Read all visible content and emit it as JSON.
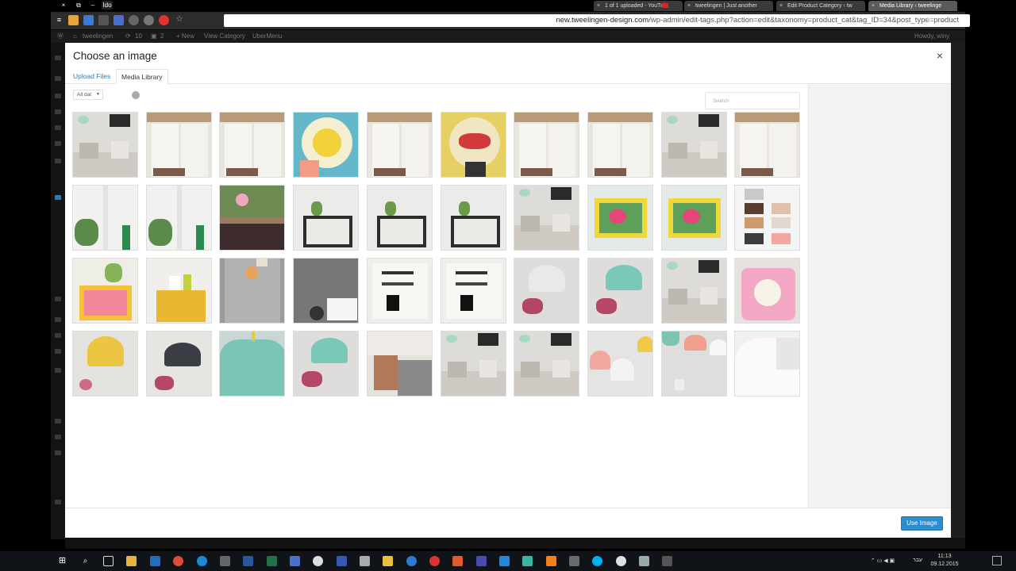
{
  "browser": {
    "window_controls": [
      "×",
      "⧉",
      "–"
    ],
    "profile_label": "Ido",
    "tabs": [
      {
        "title": "1 of 1 uploaded - YouTub",
        "has_youtube_icon": true,
        "active": false
      },
      {
        "title": "tweelingen | Just another",
        "active": false
      },
      {
        "title": "Edit Product Category ‹ tw",
        "active": false
      },
      {
        "title": "Media Library ‹ tweelinge",
        "active": true
      }
    ],
    "url": {
      "domain": "new.tweelingen-design.com",
      "path": "/wp-admin/edit-tags.php?action=edit&taxonomy=product_cat&tag_ID=34&post_type=product"
    }
  },
  "admin_bar": {
    "site_name": "tweelingen",
    "updates": "10",
    "comments": "2",
    "new_label": "+ New",
    "view_label": "View Category",
    "ubermenu_label": "UberMenu",
    "howdy": "Howdy, winy"
  },
  "modal": {
    "title": "Choose an image",
    "close_symbol": "×",
    "tabs": [
      {
        "label": "Upload Files",
        "active": false
      },
      {
        "label": "Media Library",
        "active": true
      }
    ],
    "filter": {
      "selected": "All dat",
      "caret": "▼"
    },
    "search_placeholder": "Search",
    "use_button_label": "Use Image"
  },
  "media_items": [
    {
      "scene": "sofa-pillows"
    },
    {
      "scene": "kitchen"
    },
    {
      "scene": "kitchen"
    },
    {
      "scene": "round-badge-blue"
    },
    {
      "scene": "kitchen"
    },
    {
      "scene": "round-badge-yellow"
    },
    {
      "scene": "kitchen"
    },
    {
      "scene": "kitchen"
    },
    {
      "scene": "sofa-pillows"
    },
    {
      "scene": "kitchen"
    },
    {
      "scene": "door-plant"
    },
    {
      "scene": "door-plant"
    },
    {
      "scene": "flowers-rug"
    },
    {
      "scene": "shelf-box"
    },
    {
      "scene": "shelf-box"
    },
    {
      "scene": "shelf-box"
    },
    {
      "scene": "sofa-pillows"
    },
    {
      "scene": "yellow-shelf"
    },
    {
      "scene": "yellow-shelf"
    },
    {
      "scene": "fabric-swatches"
    },
    {
      "scene": "pink-box-shelf"
    },
    {
      "scene": "yellow-box-shelf"
    },
    {
      "scene": "grey-board"
    },
    {
      "scene": "pegboard"
    },
    {
      "scene": "pattern-print"
    },
    {
      "scene": "pattern-print"
    },
    {
      "scene": "lamp-white"
    },
    {
      "scene": "lamp-mint"
    },
    {
      "scene": "sofa-pillows"
    },
    {
      "scene": "pink-pillow"
    },
    {
      "scene": "lamp-yellow"
    },
    {
      "scene": "lamp-black"
    },
    {
      "scene": "lamp-mint-close"
    },
    {
      "scene": "lamp-mint"
    },
    {
      "scene": "bedroom"
    },
    {
      "scene": "sofa-pillows"
    },
    {
      "scene": "sofa-pillows"
    },
    {
      "scene": "lamp-pink-white"
    },
    {
      "scene": "lamps-group"
    },
    {
      "scene": "lamp-white-large"
    }
  ],
  "taskbar": {
    "time": "11:13",
    "date": "09.12.2015",
    "language": "עבר"
  }
}
